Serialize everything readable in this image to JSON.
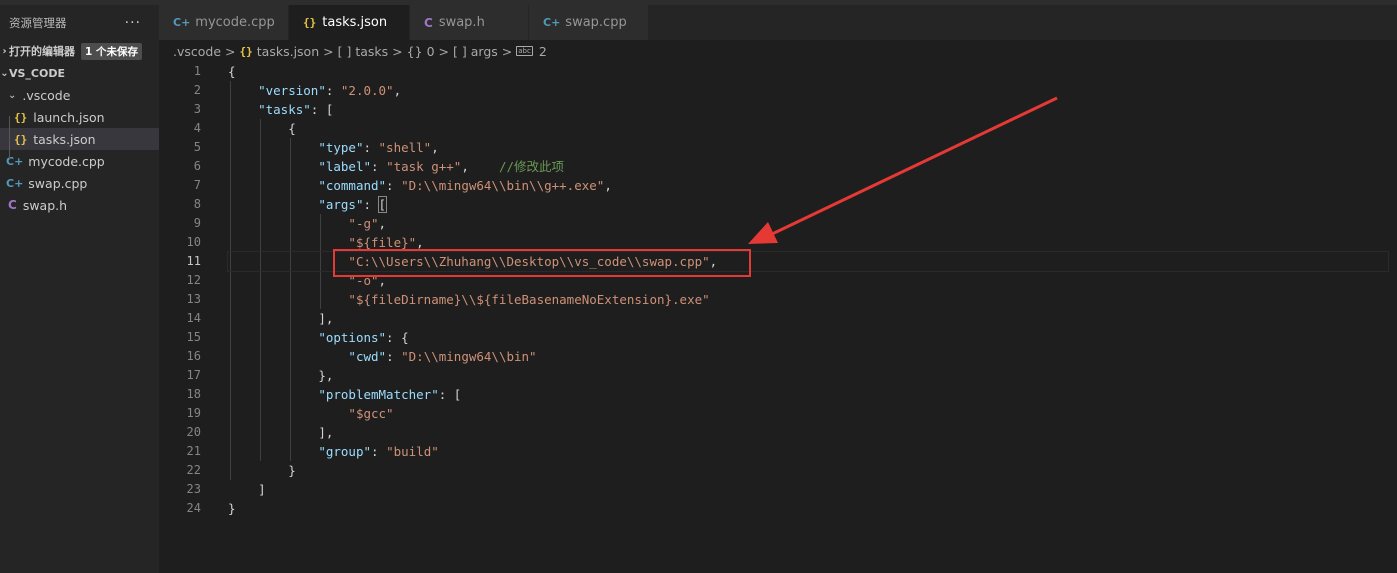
{
  "colors": {
    "accent_red": "#e53935",
    "json_icon": "#e8c54a",
    "cpp_icon": "#519aba",
    "h_icon": "#a074c4",
    "key": "#9cdcfe",
    "string": "#ce9178",
    "comment": "#6a9955"
  },
  "sidebar": {
    "title": "资源管理器",
    "more_icon": "ellipsis-icon",
    "open_editors": {
      "label": "打开的编辑器",
      "badge": "1 个未保存"
    },
    "workspace": {
      "label": "VS_CODE"
    },
    "folder": {
      "label": ".vscode"
    },
    "files": [
      {
        "name": "launch.json",
        "icon": "{}"
      },
      {
        "name": "tasks.json",
        "icon": "{}"
      },
      {
        "name": "mycode.cpp",
        "icon": "C+"
      },
      {
        "name": "swap.cpp",
        "icon": "C+"
      },
      {
        "name": "swap.h",
        "icon": "C"
      }
    ]
  },
  "tabs": [
    {
      "label": "mycode.cpp",
      "icon": "C+"
    },
    {
      "label": "tasks.json",
      "icon": "{}"
    },
    {
      "label": "swap.h",
      "icon": "C"
    },
    {
      "label": "swap.cpp",
      "icon": "C+"
    }
  ],
  "breadcrumb": {
    "items": [
      ".vscode",
      "tasks.json",
      "tasks",
      "0",
      "args",
      "2"
    ],
    "icons": [
      "{}",
      "[ ]",
      "{}",
      "[ ]"
    ],
    "separator": ">"
  },
  "editor": {
    "line_numbers": [
      "1",
      "2",
      "3",
      "4",
      "5",
      "6",
      "7",
      "8",
      "9",
      "10",
      "11",
      "12",
      "13",
      "14",
      "15",
      "16",
      "17",
      "18",
      "19",
      "20",
      "21",
      "22",
      "23",
      "24"
    ],
    "lines": {
      "l1": "{",
      "l2_key": "\"version\"",
      "l2_val": "\"2.0.0\"",
      "l3_key": "\"tasks\"",
      "l4": "{",
      "l5_key": "\"type\"",
      "l5_val": "\"shell\"",
      "l6_key": "\"label\"",
      "l6_val": "\"task g++\"",
      "l6_comment": "//修改此项",
      "l7_key": "\"command\"",
      "l7_val": "\"D:\\\\mingw64\\\\bin\\\\g++.exe\"",
      "l8_key": "\"args\"",
      "l9_val": "\"-g\"",
      "l10_val": "\"${file}\"",
      "l11_val": "\"C:\\\\Users\\\\Zhuhang\\\\Desktop\\\\vs_code\\\\swap.cpp\"",
      "l12_val": "\"-o\"",
      "l13_val": "\"${fileDirname}\\\\${fileBasenameNoExtension}.exe\"",
      "l14": "],",
      "l15_key": "\"options\"",
      "l16_key": "\"cwd\"",
      "l16_val": "\"D:\\\\mingw64\\\\bin\"",
      "l17": "},",
      "l18_key": "\"problemMatcher\"",
      "l19_val": "\"$gcc\"",
      "l20": "],",
      "l21_key": "\"group\"",
      "l21_val": "\"build\"",
      "l22": "}",
      "l23": "]",
      "l24": "}"
    }
  }
}
